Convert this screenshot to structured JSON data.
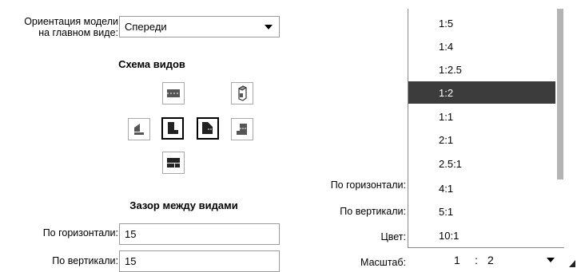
{
  "left_panel": {
    "orientation_label_line1": "Ориентация модели",
    "orientation_label_line2": "на главном виде:",
    "orientation_value": "Спереди",
    "scheme_heading": "Схема видов",
    "gap_heading": "Зазор между видами",
    "horizontal_label": "По горизонтали:",
    "horizontal_value": "15",
    "vertical_label": "По вертикали:",
    "vertical_value": "15"
  },
  "right_panel": {
    "horizontal_label": "По горизонтали:",
    "vertical_label": "По вертикали:",
    "color_label": "Цвет:",
    "scale_label": "Масштаб:",
    "scale_left": "1",
    "scale_sep": ":",
    "scale_right": "2"
  },
  "scale_dropdown": {
    "items": [
      "1:5",
      "1:4",
      "1:2.5",
      "1:2",
      "1:1",
      "2:1",
      "2.5:1",
      "4:1",
      "5:1",
      "10:1"
    ],
    "selected_index": 3
  },
  "colors": {
    "selected_bg": "#3c3c3c",
    "icon_gray": "#555555"
  },
  "icons": [
    "view-top-icon",
    "view-iso-icon",
    "view-left-icon",
    "view-front-icon",
    "view-right-icon",
    "view-back-icon",
    "view-bottom-icon",
    "dropdown-arrow-icon",
    "resize-grip-icon"
  ]
}
